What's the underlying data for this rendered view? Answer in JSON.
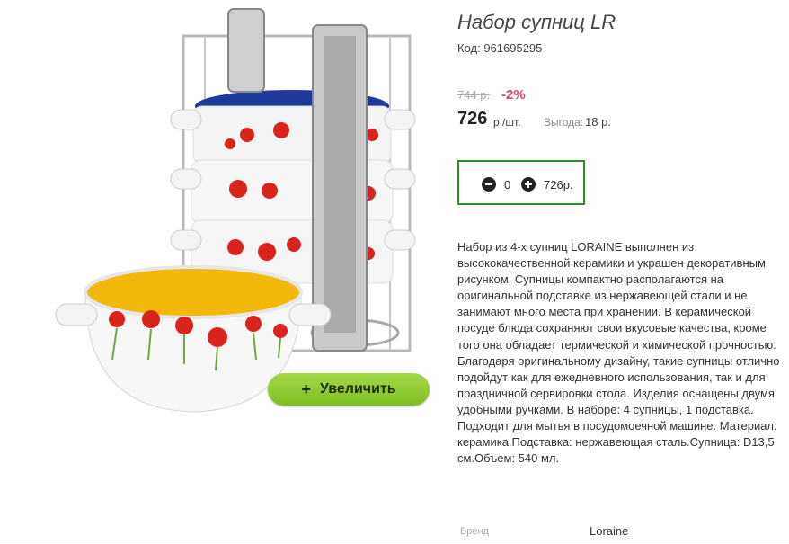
{
  "product": {
    "title": "Набор супниц LR",
    "code_label": "Код: 961695295"
  },
  "price": {
    "old": "744 р.",
    "discount": "-2%",
    "current": "726",
    "unit": "р./шт.",
    "savings_label": "Выгода:",
    "savings_value": "18 р."
  },
  "quantity": {
    "value": "0",
    "total": "726р."
  },
  "zoom_button": {
    "icon": "+",
    "label": "Увеличить"
  },
  "description": "Набор из 4-х супниц LORAINE выполнен из высококачественной керамики и украшен декоративным рисунком. Супницы компактно располагаются на оригинальной подставке из нержавеющей стали и не занимают много места при хранении. В керамической посуде блюда сохраняют свои вкусовые качества, кроме того она обладает термической и химической прочностью. Благодаря оригинальному дизайну, такие супницы отлично подойдут как для ежедневного использования, так и для праздничной сервировки стола. Изделия оснащены двумя удобными ручками. В наборе: 4 супницы, 1 подставка. Подходит для мытья в посудомоечной машине. Материал: керамика.Подставка: нержавеющая сталь.Супница: D13,5 см.Объем: 540 мл.",
  "specs": {
    "brand_label": "Бренд",
    "brand_value": "Loraine"
  },
  "colors": {
    "accent_green": "#2f8b23",
    "discount_red": "#e0455d",
    "zoom_button": "#8cc63f"
  }
}
